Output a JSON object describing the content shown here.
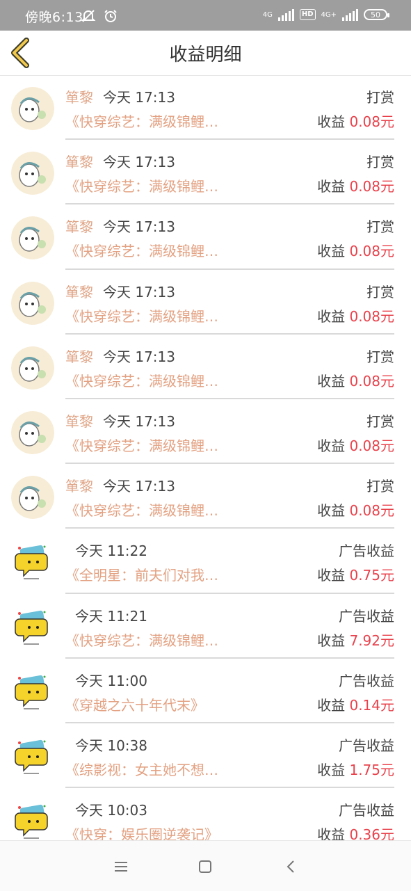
{
  "status_bar": {
    "time": "傍晚6:13",
    "network1": "4G",
    "hd": "HD",
    "network2": "4G+",
    "battery": "50"
  },
  "header": {
    "title": "收益明细",
    "back_icon": "chevron-left-icon"
  },
  "earn_label": "收益",
  "rows": [
    {
      "avatar": "user-avatar",
      "author": "箪黎",
      "time": "今天 17:13",
      "type": "打赏",
      "book": "《快穿综艺：满级锦鲤…",
      "amount": "0.08元"
    },
    {
      "avatar": "user-avatar",
      "author": "箪黎",
      "time": "今天 17:13",
      "type": "打赏",
      "book": "《快穿综艺：满级锦鲤…",
      "amount": "0.08元"
    },
    {
      "avatar": "user-avatar",
      "author": "箪黎",
      "time": "今天 17:13",
      "type": "打赏",
      "book": "《快穿综艺：满级锦鲤…",
      "amount": "0.08元"
    },
    {
      "avatar": "user-avatar",
      "author": "箪黎",
      "time": "今天 17:13",
      "type": "打赏",
      "book": "《快穿综艺：满级锦鲤…",
      "amount": "0.08元"
    },
    {
      "avatar": "user-avatar",
      "author": "箪黎",
      "time": "今天 17:13",
      "type": "打赏",
      "book": "《快穿综艺：满级锦鲤…",
      "amount": "0.08元"
    },
    {
      "avatar": "user-avatar",
      "author": "箪黎",
      "time": "今天 17:13",
      "type": "打赏",
      "book": "《快穿综艺：满级锦鲤…",
      "amount": "0.08元"
    },
    {
      "avatar": "user-avatar",
      "author": "箪黎",
      "time": "今天 17:13",
      "type": "打赏",
      "book": "《快穿综艺：满级锦鲤…",
      "amount": "0.08元"
    },
    {
      "avatar": "ad-icon",
      "author": "",
      "time": "今天 11:22",
      "type": "广告收益",
      "book": "《全明星：前夫们对我…",
      "amount": "0.75元"
    },
    {
      "avatar": "ad-icon",
      "author": "",
      "time": "今天 11:21",
      "type": "广告收益",
      "book": "《快穿综艺：满级锦鲤…",
      "amount": "7.92元"
    },
    {
      "avatar": "ad-icon",
      "author": "",
      "time": "今天 11:00",
      "type": "广告收益",
      "book": "《穿越之六十年代末》",
      "amount": "0.14元"
    },
    {
      "avatar": "ad-icon",
      "author": "",
      "time": "今天 10:38",
      "type": "广告收益",
      "book": "《综影视：女主她不想…",
      "amount": "1.75元"
    },
    {
      "avatar": "ad-icon",
      "author": "",
      "time": "今天 10:03",
      "type": "广告收益",
      "book": "《快穿：娱乐圈逆袭记》",
      "amount": "0.36元"
    }
  ],
  "nav": {
    "menu_icon": "menu-icon",
    "home_icon": "home-square-icon",
    "back_icon": "back-triangle-icon"
  },
  "colors": {
    "accent_author": "#e0a587",
    "amount": "#e8414b",
    "back_chevron": "#f2c94c"
  }
}
